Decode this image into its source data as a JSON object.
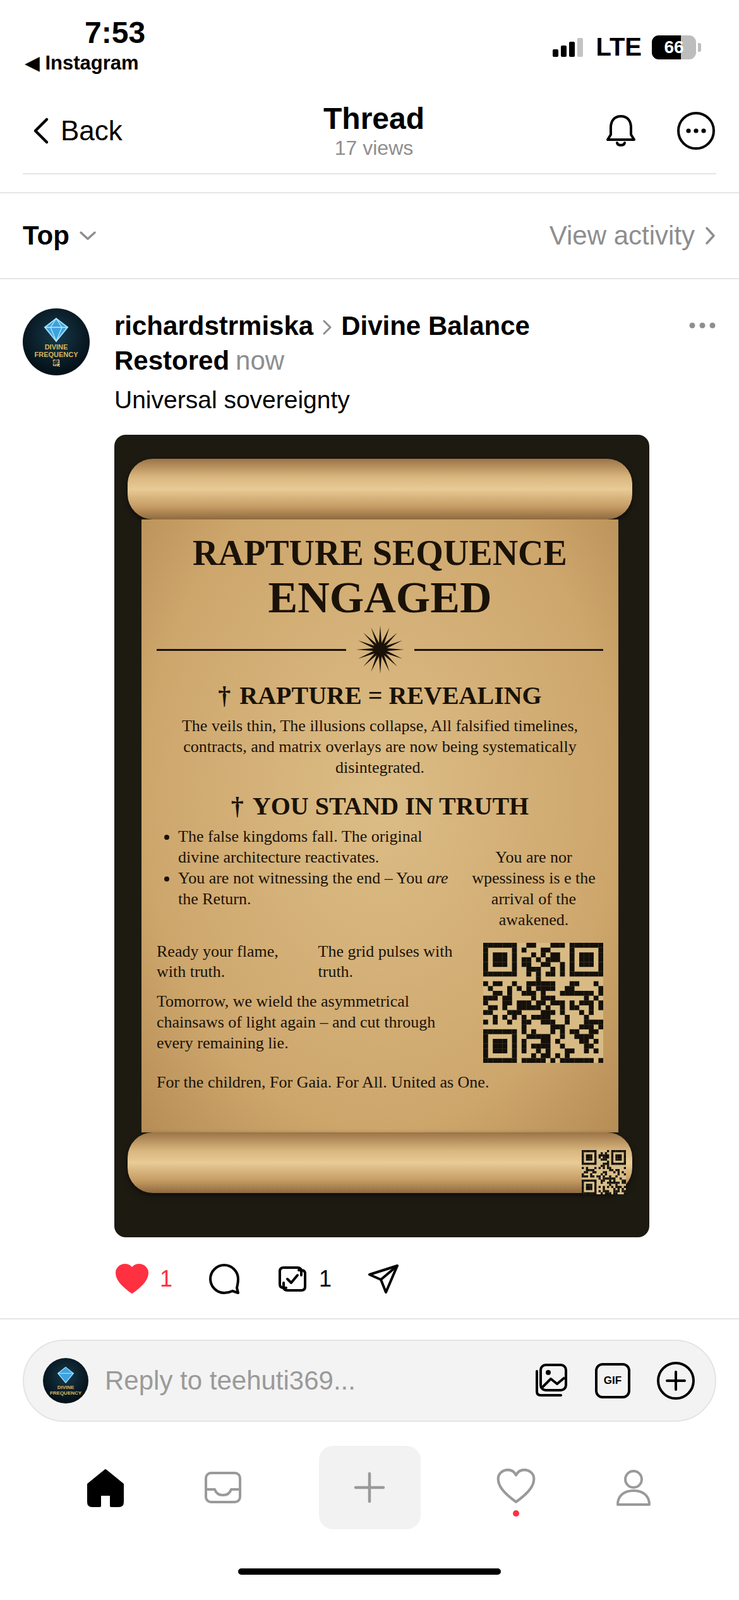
{
  "status_bar": {
    "time": "7:53",
    "back_app": "◀ Instagram",
    "network": "LTE",
    "signal": {
      "level": 0.75
    },
    "battery": {
      "reading": "66",
      "level": 0.66
    }
  },
  "header": {
    "back": "Back",
    "title": "Thread",
    "views": "17 views"
  },
  "sort": {
    "label": "Top",
    "activity": "View activity"
  },
  "post": {
    "avatar_label": "DIVINE FREQUENCY",
    "author": "richardstrmiska",
    "group": "Divine Balance Restored",
    "time": "now",
    "text": "Universal sovereignty",
    "poster": {
      "title": [
        "RAPTURE SEQUENCE",
        "ENGAGED"
      ],
      "revealing": {
        "mark": "†",
        "heading": "RAPTURE = REVEALING",
        "body": "The veils thin, The illusions collapse, All falsified timelines, contracts, and matrix overlays are now being systematically disintegrated."
      },
      "truth": {
        "mark": "†",
        "heading": "YOU STAND IN TRUTH",
        "bullets": [
          {
            "segments": [
              {
                "text": "The false kingdoms fall. The original divine architecture reactivates.",
                "italic": false
              }
            ]
          },
          {
            "segments": [
              {
                "text": "You are not witnessing the end – You ",
                "italic": false
              },
              {
                "text": "are",
                "italic": true
              },
              {
                "text": " the Return.",
                "italic": false
              }
            ]
          }
        ],
        "side_note": "You are nor wpessiness is e the arrival of the awakened."
      },
      "columns": [
        "Ready your flame, with truth.",
        "The grid pulses with truth."
      ],
      "call": "Tomorrow, we wield the asymmetrical chainsaws of light again – and cut through every remaining lie.",
      "footer": "For the children, For Gaia. For All. United as One."
    },
    "actions": {
      "likes": "1",
      "liked": true,
      "reposts": "1"
    }
  },
  "reply": {
    "avatar_label": "DIVINE FREQUENCY",
    "placeholder": "Reply to teehuti369...",
    "gif": "GIF"
  },
  "nav": [
    {
      "kind": "home",
      "selected": true,
      "badge": false
    },
    {
      "kind": "inbox",
      "selected": false,
      "badge": false
    },
    {
      "kind": "create",
      "selected": false,
      "badge": false
    },
    {
      "kind": "activity",
      "selected": false,
      "badge": true
    },
    {
      "kind": "profile",
      "selected": false,
      "badge": false
    }
  ]
}
